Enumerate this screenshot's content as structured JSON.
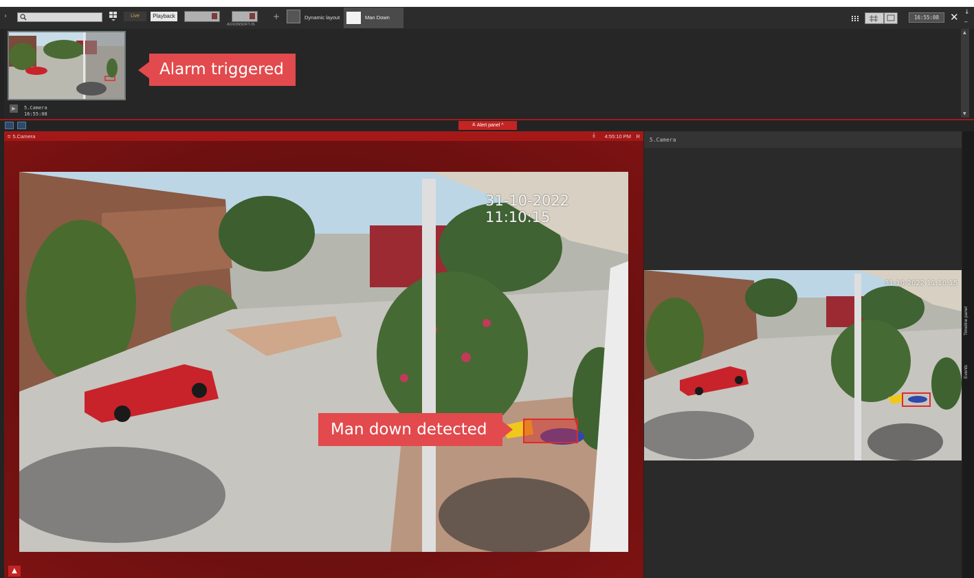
{
  "toolbar": {
    "search_placeholder": "",
    "live_label": "Live",
    "playback_label": "Playback",
    "server_label": "AXXONSOFT-IS",
    "dynamic_layout_label": "Dynamic layout",
    "active_tab_label": "Man Down",
    "clock": "16:55:08"
  },
  "alarm": {
    "camera_name": "5.Camera",
    "time": "16:55:08",
    "callout": "Alarm triggered"
  },
  "alert_panel": {
    "label": "Alert panel"
  },
  "main_view": {
    "camera_name": "5.Camera",
    "time": "4:55:10 PM",
    "rec_indicator": "R",
    "osd_timestamp": "31-10-2022 11:10:15",
    "callout": "Man down detected"
  },
  "side_view": {
    "camera_name": "5.Camera",
    "osd_timestamp": "31-10-2022 11:10:15"
  },
  "side_tabs": {
    "timeline": "Timeline panel",
    "events": "Events"
  },
  "colors": {
    "alert_red": "#c42424",
    "callout_red": "#e24a4d",
    "live_orange": "#d9a640"
  }
}
